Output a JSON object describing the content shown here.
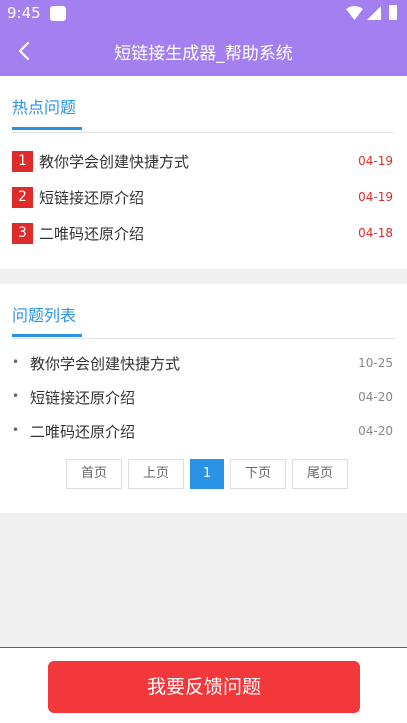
{
  "status_bar": {
    "time": "9:45"
  },
  "app_bar": {
    "title": "短链接生成器_帮助系统"
  },
  "hot": {
    "heading": "热点问题",
    "items": [
      {
        "rank": "1",
        "label": "教你学会创建快捷方式",
        "date": "04-19"
      },
      {
        "rank": "2",
        "label": "短链接还原介绍",
        "date": "04-19"
      },
      {
        "rank": "3",
        "label": "二唯码还原介绍",
        "date": "04-18"
      }
    ]
  },
  "list": {
    "heading": "问题列表",
    "bullet": "•",
    "items": [
      {
        "label": "教你学会创建快捷方式",
        "date": "10-25"
      },
      {
        "label": "短链接还原介绍",
        "date": "04-20"
      },
      {
        "label": "二唯码还原介绍",
        "date": "04-20"
      }
    ]
  },
  "pager": {
    "first": "首页",
    "prev": "上页",
    "current": "1",
    "next": "下页",
    "last": "尾页"
  },
  "feedback_button": "我要反馈问题",
  "colors": {
    "accent_purple": "#a47ff0",
    "link_blue": "#2a93e6",
    "hot_red": "#e02b2b",
    "button_red": "#f2383b"
  }
}
